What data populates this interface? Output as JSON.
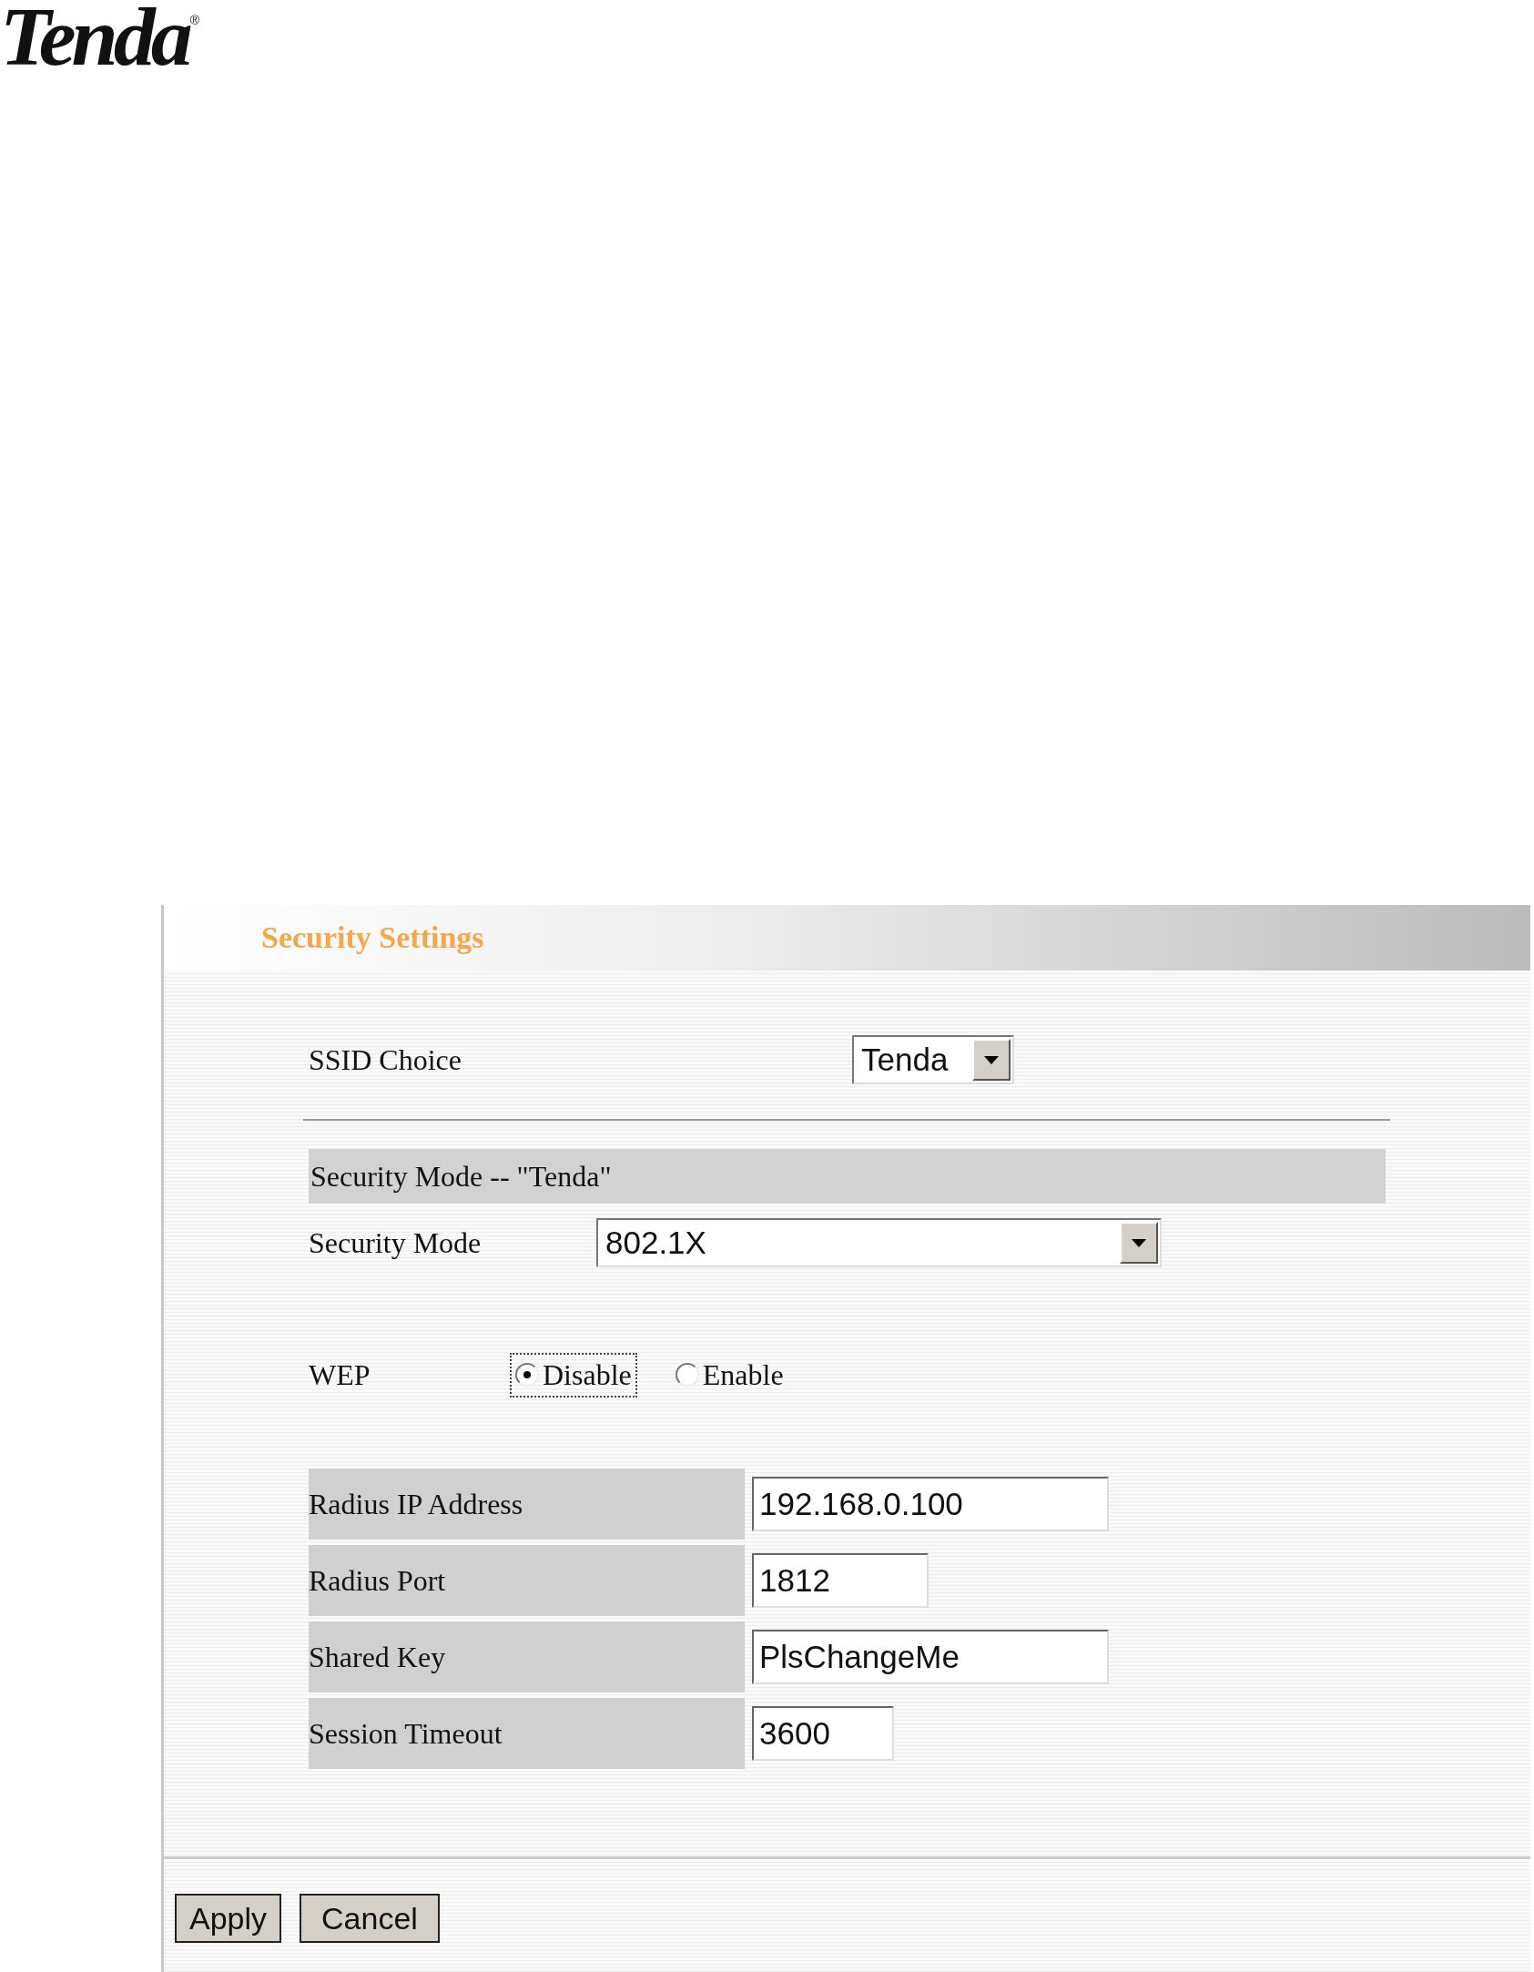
{
  "logo": {
    "text": "Tenda",
    "mark": "®"
  },
  "panel": {
    "title": "Security Settings"
  },
  "ssid": {
    "label": "SSID Choice",
    "value": "Tenda"
  },
  "section": {
    "title": "Security Mode -- \"Tenda\""
  },
  "security_mode": {
    "label": "Security Mode",
    "value": "802.1X"
  },
  "wep": {
    "label": "WEP",
    "options": [
      {
        "label": "Disable",
        "selected": true
      },
      {
        "label": "Enable",
        "selected": false
      }
    ]
  },
  "radius_fields": [
    {
      "label": "Radius IP Address",
      "value": "192.168.0.100"
    },
    {
      "label": "Radius Port",
      "value": "1812"
    },
    {
      "label": "Shared Key",
      "value": "PlsChangeMe"
    },
    {
      "label": "Session Timeout",
      "value": "3600"
    }
  ],
  "buttons": [
    {
      "label": "Apply"
    },
    {
      "label": "Cancel"
    }
  ]
}
